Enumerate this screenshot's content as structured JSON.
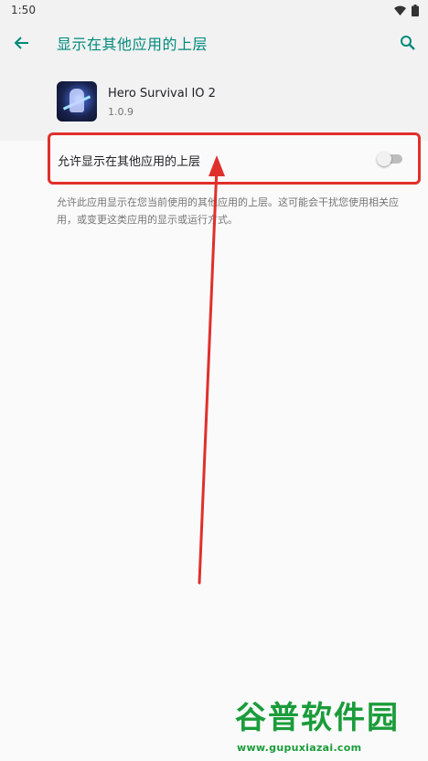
{
  "status_bar": {
    "time": "1:50",
    "icons": [
      "wifi-icon",
      "battery-icon"
    ]
  },
  "toolbar": {
    "title": "显示在其他应用的上层",
    "accent": "#00897b"
  },
  "app": {
    "name": "Hero Survival IO 2",
    "version": "1.0.9"
  },
  "setting": {
    "label": "允许显示在其他应用的上层",
    "enabled": false
  },
  "description": "允许此应用显示在您当前使用的其他应用的上层。这可能会干扰您使用相关应用，或变更这类应用的显示或运行方式。",
  "annotation": {
    "color": "#e0302b"
  },
  "watermark": {
    "title": "谷普软件园",
    "url": "www.gupuxiazai.com",
    "color": "#1a9c3a"
  }
}
